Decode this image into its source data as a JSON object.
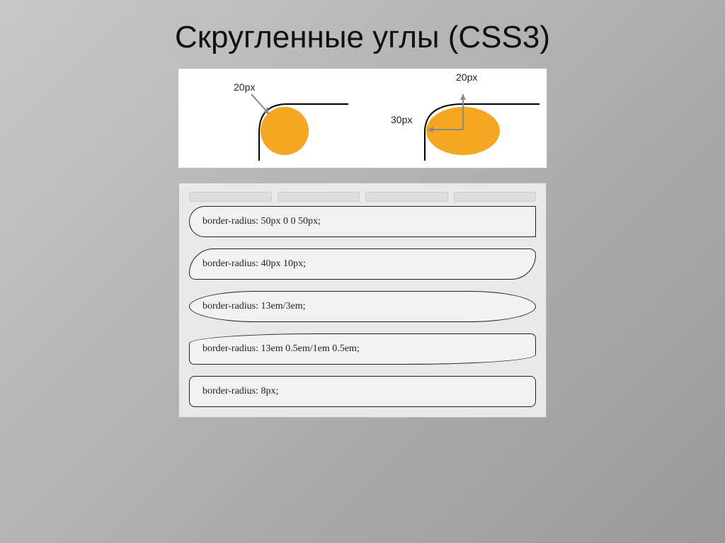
{
  "title": "Скругленные углы (CSS3)",
  "diagram": {
    "label_left": "20px",
    "label_right_top": "20px",
    "label_right_mid": "30px"
  },
  "samples": [
    {
      "text": "border-radius: 50px 0 0 50px;"
    },
    {
      "text": "border-radius: 40px 10px;"
    },
    {
      "text": "border-radius: 13em/3em;"
    },
    {
      "text": "border-radius: 13em 0.5em/1em 0.5em;"
    },
    {
      "text": "border-radius: 8px;"
    }
  ]
}
